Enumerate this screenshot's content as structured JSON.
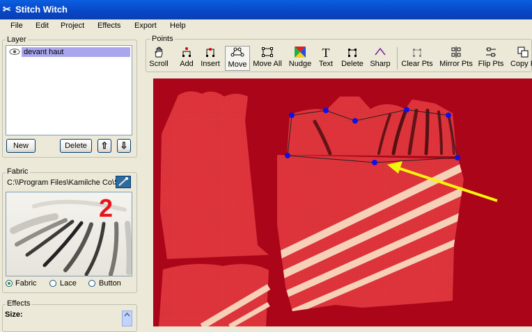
{
  "window": {
    "title": "Stitch Witch"
  },
  "menu": [
    "File",
    "Edit",
    "Project",
    "Effects",
    "Export",
    "Help"
  ],
  "layer_panel": {
    "label": "Layer",
    "items": [
      {
        "name": "devant haut"
      }
    ],
    "new_label": "New",
    "delete_label": "Delete",
    "up_glyph": "⇧",
    "down_glyph": "⇩"
  },
  "fabric_panel": {
    "label": "Fabric",
    "path": "C:\\\\Program Files\\Kamilche Co\\Sting",
    "annotation": "2",
    "options": [
      "Fabric",
      "Lace",
      "Button"
    ],
    "selected": "Fabric"
  },
  "effects_panel": {
    "label": "Effects",
    "size_label": "Size:"
  },
  "points_toolbar": {
    "label": "Points",
    "tools": [
      {
        "label": "Scroll",
        "icon": "hand-icon"
      },
      {
        "label": "Add",
        "icon": "add-point-icon"
      },
      {
        "label": "Insert",
        "icon": "insert-point-icon"
      },
      {
        "label": "Move",
        "icon": "move-points-icon",
        "active": true
      },
      {
        "label": "Move All",
        "icon": "move-all-icon"
      },
      {
        "label": "Nudge",
        "icon": "nudge-icon"
      },
      {
        "label": "Text",
        "icon": "text-icon",
        "glyph": "T"
      },
      {
        "label": "Delete",
        "icon": "delete-point-icon"
      },
      {
        "label": "Sharp",
        "icon": "sharp-icon"
      },
      {
        "label": "Clear Pts",
        "icon": "clear-points-icon"
      },
      {
        "label": "Mirror Pts",
        "icon": "mirror-points-icon"
      },
      {
        "label": "Flip Pts",
        "icon": "flip-points-icon"
      },
      {
        "label": "Copy P",
        "icon": "copy-points-icon"
      }
    ]
  },
  "colors": {
    "canvas_bg": "#aa0519",
    "fabric_red": "#e0353c",
    "point_blue": "#1010e6",
    "arrow_yellow": "#f5f50a",
    "annotation_red": "#e8141c"
  }
}
